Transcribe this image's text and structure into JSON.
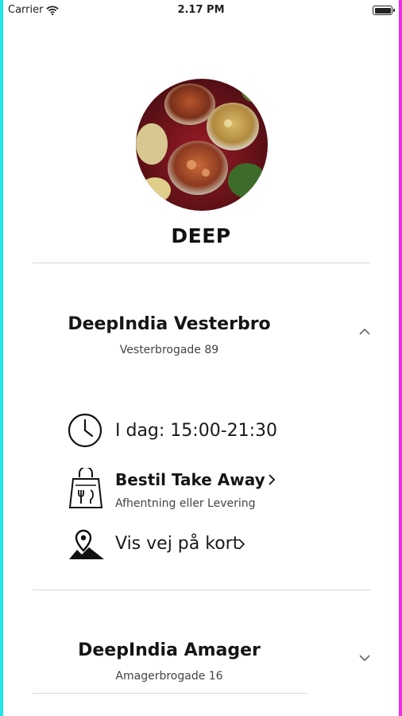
{
  "status_bar": {
    "carrier": "Carrier",
    "time": "2.17 PM"
  },
  "brand": {
    "name": "DEEP",
    "avatar_icon": "food-photo"
  },
  "locations": [
    {
      "name": "DeepIndia Vesterbro",
      "address": "Vesterbrogade 89",
      "expanded": true,
      "hours": "I dag: 15:00-21:30",
      "order": {
        "title": "Bestil Take Away",
        "subtitle": "Afhentning eller Levering"
      },
      "directions": "Vis vej på kort"
    },
    {
      "name": "DeepIndia Amager",
      "address": "Amagerbrogade 16",
      "expanded": false
    }
  ],
  "colors": {
    "frame_left": "#22e3e8",
    "frame_right": "#ee2ee0",
    "divider": "#d8d8d8",
    "text": "#151515"
  }
}
